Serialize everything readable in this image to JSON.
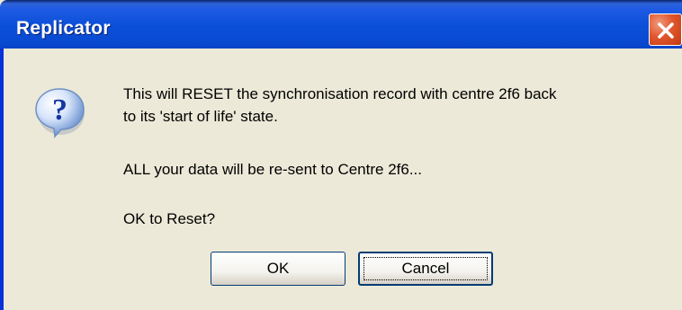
{
  "window": {
    "title": "Replicator",
    "close_icon": "close-icon"
  },
  "dialog": {
    "icon": "question-icon",
    "lines": [
      "This will RESET the synchronisation record with centre 2f6 back",
      "to its 'start of life' state.",
      "ALL your data will be re-sent to Centre 2f6...",
      "OK to Reset?"
    ]
  },
  "buttons": {
    "ok_label": "OK",
    "cancel_label": "Cancel"
  },
  "colors": {
    "titlebar": "#0b4fd8",
    "dialog_background": "#ece9d8",
    "close_button": "#e1562d",
    "focus_border": "#003c74"
  }
}
